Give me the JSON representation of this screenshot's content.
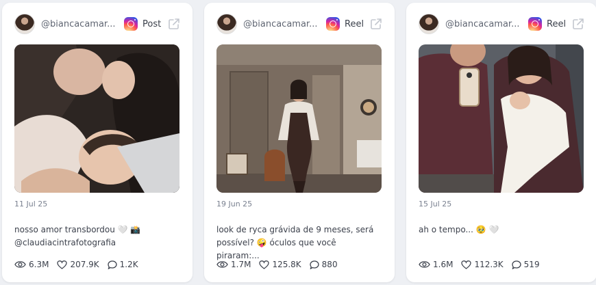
{
  "posts": [
    {
      "handle": "@biancacamar...",
      "type": "Post",
      "date": "11 Jul 25",
      "caption_line1": "nosso amor transbordou 🤍 📸",
      "caption_line2": "@claudiacintrafotografia",
      "views": "6.3M",
      "likes": "207.9K",
      "comments": "1.2K"
    },
    {
      "handle": "@biancacamar...",
      "type": "Reel",
      "date": "19 Jun 25",
      "caption_line1": "look de ryca grávida de 9 meses, será",
      "caption_line2": "possível? 🤪 óculos que você piraram:...",
      "views": "1.7M",
      "likes": "125.8K",
      "comments": "880"
    },
    {
      "handle": "@biancacamar...",
      "type": "Reel",
      "date": "15 Jul 25",
      "caption_line1": "ah o tempo... 🥹 🤍",
      "caption_line2": "",
      "views": "1.6M",
      "likes": "112.3K",
      "comments": "519"
    }
  ],
  "colors": {
    "brand_instagram": "#d6249f",
    "text": "#3c414c",
    "muted": "#7a8190"
  }
}
